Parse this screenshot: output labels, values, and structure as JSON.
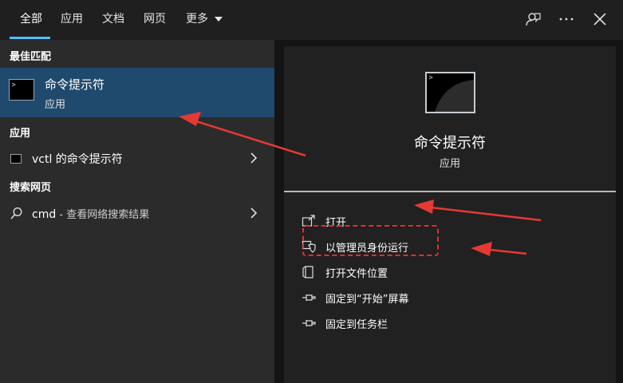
{
  "topbar": {
    "tabs": [
      {
        "label": "全部"
      },
      {
        "label": "应用"
      },
      {
        "label": "文档"
      },
      {
        "label": "网页"
      },
      {
        "label": "更多"
      }
    ],
    "icons": [
      "feedback-icon",
      "more-icon",
      "close-icon"
    ]
  },
  "left": {
    "best_match_header": "最佳匹配",
    "best_match": {
      "title": "命令提示符",
      "subtitle": "应用"
    },
    "apps_header": "应用",
    "app_result": {
      "label": "vctl 的命令提示符"
    },
    "web_header": "搜索网页",
    "web_result": {
      "query": "cmd",
      "hint": " - 查看网络搜索结果"
    }
  },
  "right": {
    "title": "命令提示符",
    "subtitle": "应用",
    "actions": [
      {
        "label": "打开",
        "icon": "open-icon"
      },
      {
        "label": "以管理员身份运行",
        "icon": "shield-icon"
      },
      {
        "label": "打开文件位置",
        "icon": "file-location-icon"
      },
      {
        "label": "固定到“开始”屏幕",
        "icon": "pin-icon"
      },
      {
        "label": "固定到任务栏",
        "icon": "pin-icon"
      }
    ]
  },
  "colors": {
    "accent": "#4cc2ff",
    "selected_row": "#204a6d",
    "annotation_red": "#e0302a"
  }
}
